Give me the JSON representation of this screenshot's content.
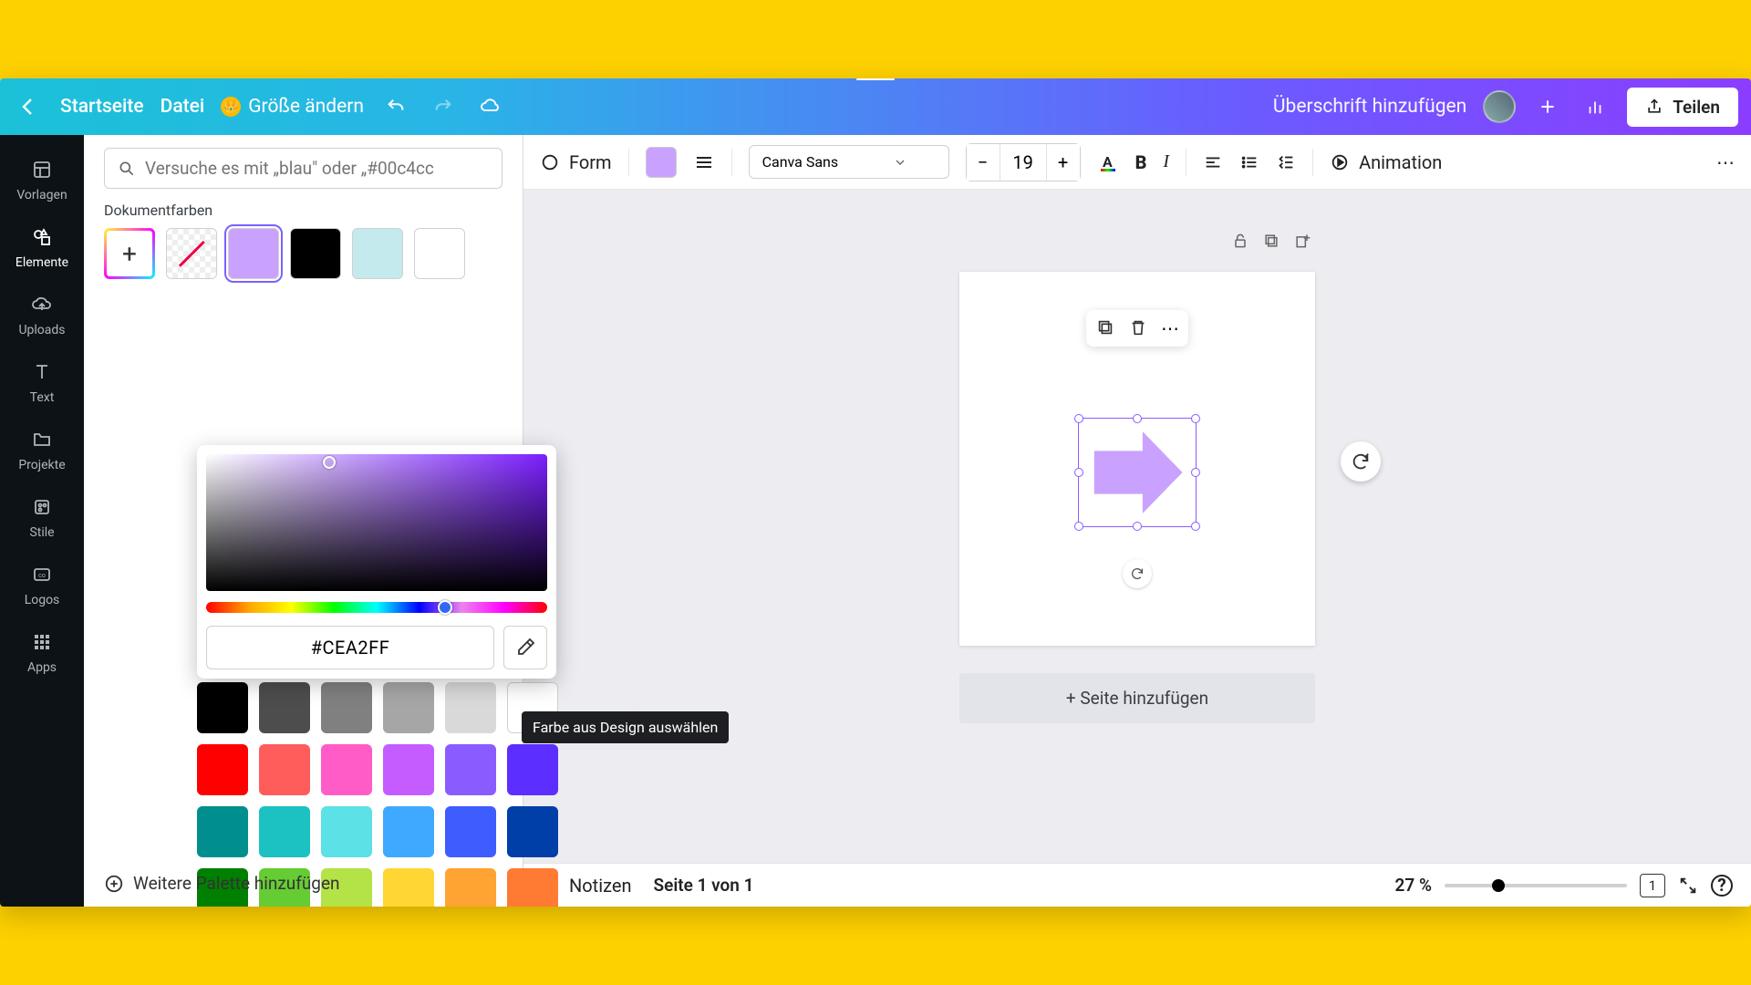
{
  "header": {
    "home": "Startseite",
    "file": "Datei",
    "resize": "Größe ändern",
    "title": "Überschrift hinzufügen",
    "share": "Teilen"
  },
  "rail": {
    "templates": "Vorlagen",
    "elements": "Elemente",
    "uploads": "Uploads",
    "text": "Text",
    "projects": "Projekte",
    "styles": "Stile",
    "logos": "Logos",
    "apps": "Apps"
  },
  "panel": {
    "search_placeholder": "Versuche es mit „blau\" oder „#00c4cc",
    "doc_colors": "Dokumentfarben",
    "hex_value": "#CEA2FF",
    "tooltip": "Farbe aus Design auswählen",
    "add_palette": "Weitere Palette hinzufügen",
    "doc_swatches": [
      "#c9a2ff",
      "#000000",
      "#c4eaee",
      "#ffffff"
    ],
    "default_colors": [
      "#000000",
      "#4d4d4d",
      "#808080",
      "#a6a6a6",
      "#d9d9d9",
      "#ffffff",
      "#ff0000",
      "#ff5c5c",
      "#ff5cc8",
      "#c45cff",
      "#8a5cff",
      "#5c2eff",
      "#008e8e",
      "#1cc1c1",
      "#5ce1e6",
      "#3fa9ff",
      "#3f5cff",
      "#003ea8",
      "#008000",
      "#66cc33",
      "#b3e346",
      "#ffd633",
      "#ffa333",
      "#ff7a33"
    ]
  },
  "toolbar": {
    "form": "Form",
    "font": "Canva Sans",
    "font_size": "19",
    "animation": "Animation",
    "current_color": "#c9a2ff"
  },
  "footer": {
    "notes": "Notizen",
    "page": "Seite 1 von 1",
    "zoom": "27 %",
    "page_badge": "1"
  },
  "stage": {
    "add_page": "+ Seite hinzufügen"
  }
}
